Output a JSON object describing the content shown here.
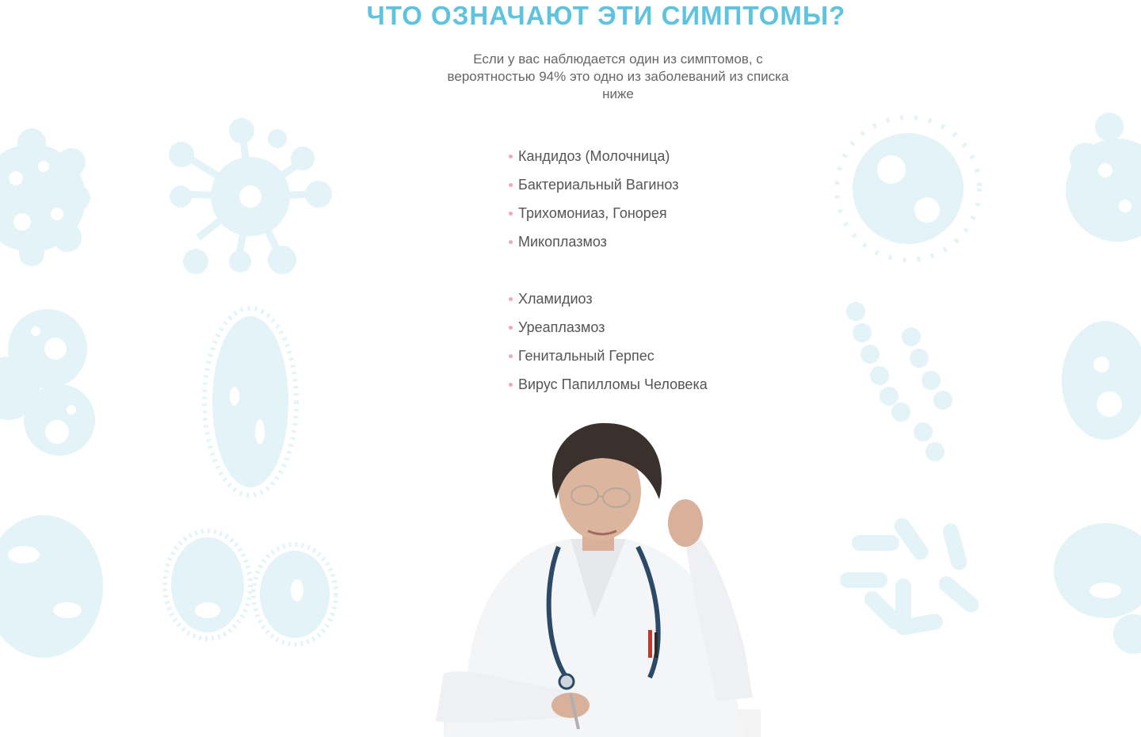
{
  "section": {
    "title": "ЧТО ОЗНАЧАЮТ ЭТИ СИМПТОМЫ?",
    "subtitle": "Если у вас наблюдается один из симптомов, с вероятностью 94% это одно из заболеваний из списка ниже"
  },
  "diseases": [
    "Кандидоз (Молочница)",
    "Бактериальный Вагиноз",
    "Трихомониаз, Гонорея",
    "Микоплазмоз",
    "Хламидиоз",
    "Уреаплазмоз",
    "Генитальный Герпес",
    "Вирус Папилломы Человека"
  ],
  "image": {
    "subject": "doctor-photo"
  },
  "colors": {
    "accent": "#5ec3df",
    "text": "#555555",
    "bullet": "#f3a7b8",
    "pattern": "#e3f3f8"
  }
}
